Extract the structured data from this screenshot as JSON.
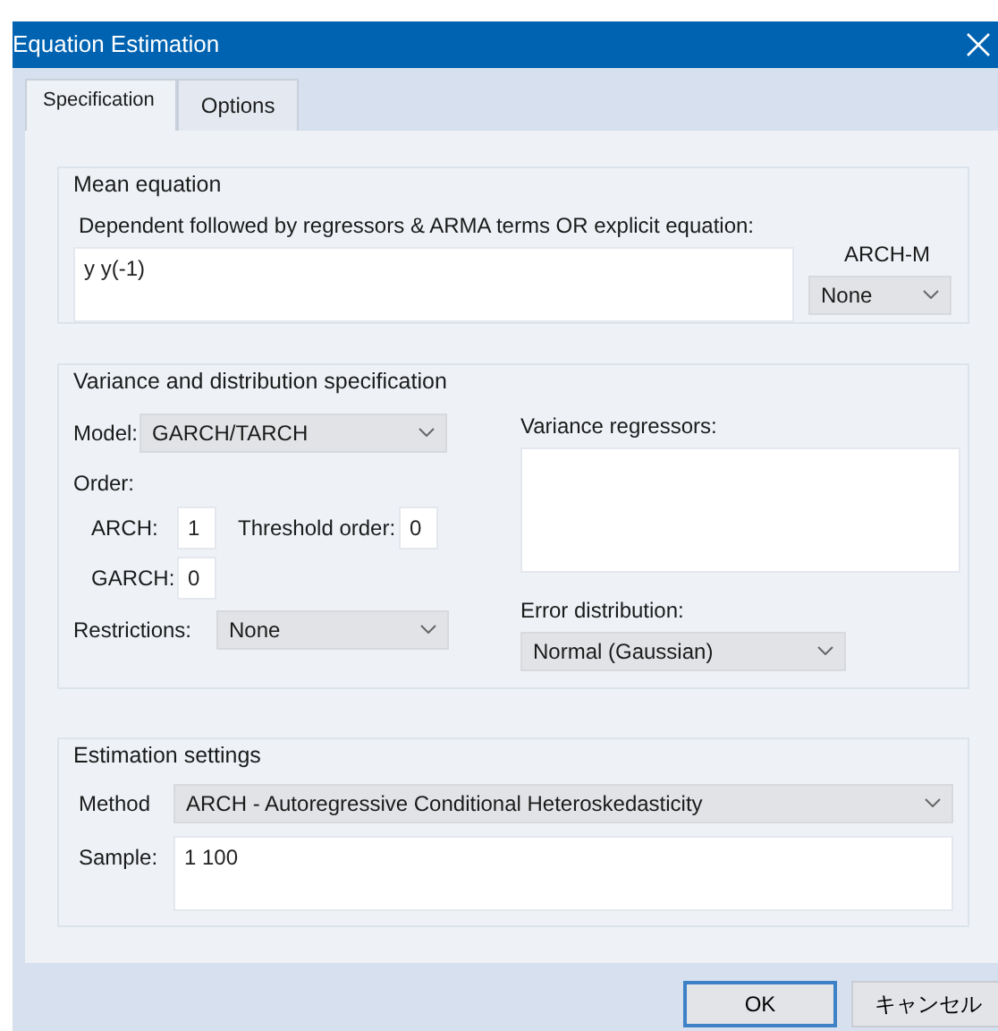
{
  "window": {
    "title": "Equation Estimation"
  },
  "tabs": [
    {
      "label": "Specification",
      "selected": true
    },
    {
      "label": "Options",
      "selected": false
    }
  ],
  "mean_equation": {
    "title": "Mean equation",
    "prompt": "Dependent followed by regressors & ARMA terms OR explicit equation:",
    "value": "y y(-1)",
    "arch_m": {
      "label": "ARCH-M",
      "value": "None"
    }
  },
  "variance": {
    "title": "Variance and distribution specification",
    "model": {
      "label": "Model:",
      "value": "GARCH/TARCH"
    },
    "order_label": "Order:",
    "arch": {
      "label": "ARCH:",
      "value": "1"
    },
    "threshold": {
      "label": "Threshold order:",
      "value": "0"
    },
    "garch": {
      "label": "GARCH:",
      "value": "0"
    },
    "restrictions": {
      "label": "Restrictions:",
      "value": "None"
    },
    "variance_regressors": {
      "label": "Variance regressors:"
    },
    "error_distribution": {
      "label": "Error distribution:",
      "value": "Normal (Gaussian)"
    }
  },
  "estimation": {
    "title": "Estimation settings",
    "method": {
      "label": "Method",
      "value": "ARCH  -  Autoregressive Conditional Heteroskedasticity"
    },
    "sample": {
      "label": "Sample:",
      "value": "1 100"
    }
  },
  "buttons": [
    {
      "label": "OK",
      "default": true
    },
    {
      "label": "キャンセル",
      "default": false
    }
  ]
}
